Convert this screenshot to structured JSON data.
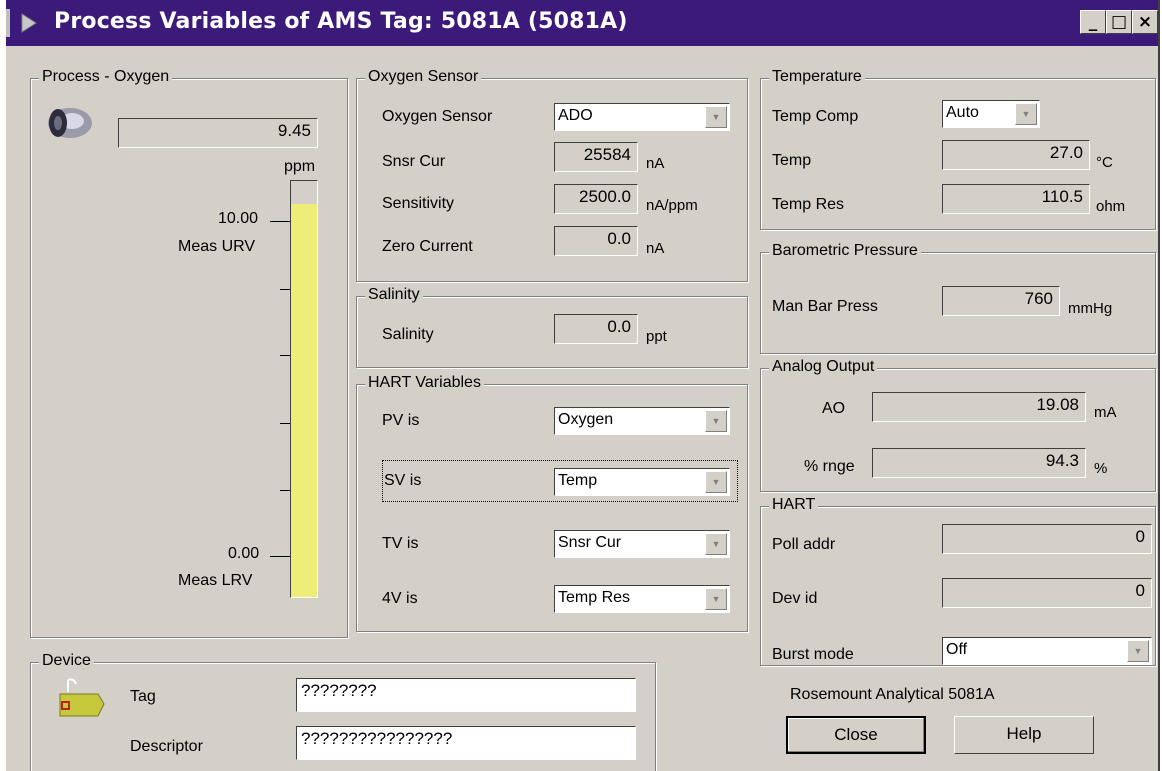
{
  "window": {
    "title": "Process Variables of AMS Tag: 5081A (5081A)",
    "controls": {
      "minimize": "_",
      "maximize": "□",
      "close": "×"
    }
  },
  "process": {
    "group_label": "Process - Oxygen",
    "value": "9.45",
    "unit": "ppm",
    "urv_value": "10.00",
    "urv_label": "Meas URV",
    "lrv_value": "0.00",
    "lrv_label": "Meas LRV",
    "bar_fill_fraction": 0.945,
    "bar_color": "#eded78",
    "icon": "sensor-probe-icon"
  },
  "oxygen_sensor": {
    "group_label": "Oxygen Sensor",
    "sensor_label": "Oxygen Sensor",
    "sensor_value": "ADO",
    "snsr_cur_label": "Snsr Cur",
    "snsr_cur_value": "25584",
    "snsr_cur_unit": "nA",
    "sensitivity_label": "Sensitivity",
    "sensitivity_value": "2500.0",
    "sensitivity_unit": "nA/ppm",
    "zero_current_label": "Zero Current",
    "zero_current_value": "0.0",
    "zero_current_unit": "nA"
  },
  "salinity": {
    "group_label": "Salinity",
    "label": "Salinity",
    "value": "0.0",
    "unit": "ppt"
  },
  "hart_variables": {
    "group_label": "HART Variables",
    "pv_label": "PV is",
    "pv_value": "Oxygen",
    "sv_label": "SV is",
    "sv_value": "Temp",
    "tv_label": "TV is",
    "tv_value": "Snsr Cur",
    "qv_label": "4V is",
    "qv_value": "Temp Res"
  },
  "temperature": {
    "group_label": "Temperature",
    "comp_label": "Temp Comp",
    "comp_value": "Auto",
    "temp_label": "Temp",
    "temp_value": "27.0",
    "temp_unit": "°C",
    "res_label": "Temp Res",
    "res_value": "110.5",
    "res_unit": "ohm"
  },
  "barometric": {
    "group_label": "Barometric Pressure",
    "label": "Man Bar Press",
    "value": "760",
    "unit": "mmHg"
  },
  "analog_output": {
    "group_label": "Analog Output",
    "ao_label": "AO",
    "ao_value": "19.08",
    "ao_unit": "mA",
    "range_label": "% rnge",
    "range_value": "94.3",
    "range_unit": "%"
  },
  "hart": {
    "group_label": "HART",
    "poll_label": "Poll addr",
    "poll_value": "0",
    "devid_label": "Dev id",
    "devid_value": "0",
    "burst_label": "Burst mode",
    "burst_value": "Off"
  },
  "device": {
    "group_label": "Device",
    "tag_label": "Tag",
    "tag_value": "????????",
    "desc_label": "Descriptor",
    "desc_value": "????????????????",
    "icon": "tag-icon"
  },
  "footer": {
    "model": "Rosemount Analytical 5081A",
    "close_label": "Close",
    "help_label": "Help"
  }
}
